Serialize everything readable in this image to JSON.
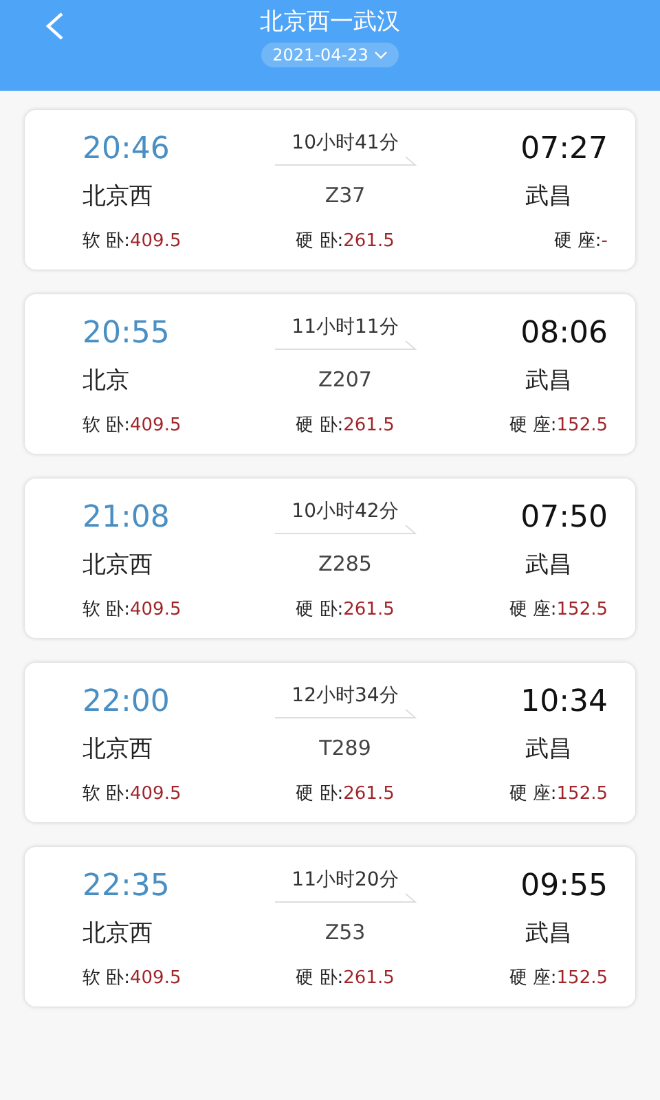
{
  "header": {
    "title": "北京西一武汉",
    "date": "2021-04-23"
  },
  "trains": [
    {
      "depart_time": "20:46",
      "duration": "10小时41分",
      "arrive_time": "07:27",
      "from": "北京西",
      "train_no": "Z37",
      "to": "武昌",
      "fares": [
        {
          "label": "软 卧:",
          "price": "409.5"
        },
        {
          "label": "硬 卧:",
          "price": "261.5"
        },
        {
          "label": "硬 座:",
          "price": "-"
        }
      ]
    },
    {
      "depart_time": "20:55",
      "duration": "11小时11分",
      "arrive_time": "08:06",
      "from": "北京",
      "train_no": "Z207",
      "to": "武昌",
      "fares": [
        {
          "label": "软 卧:",
          "price": "409.5"
        },
        {
          "label": "硬 卧:",
          "price": "261.5"
        },
        {
          "label": "硬 座:",
          "price": "152.5"
        }
      ]
    },
    {
      "depart_time": "21:08",
      "duration": "10小时42分",
      "arrive_time": "07:50",
      "from": "北京西",
      "train_no": "Z285",
      "to": "武昌",
      "fares": [
        {
          "label": "软 卧:",
          "price": "409.5"
        },
        {
          "label": "硬 卧:",
          "price": "261.5"
        },
        {
          "label": "硬 座:",
          "price": "152.5"
        }
      ]
    },
    {
      "depart_time": "22:00",
      "duration": "12小时34分",
      "arrive_time": "10:34",
      "from": "北京西",
      "train_no": "T289",
      "to": "武昌",
      "fares": [
        {
          "label": "软 卧:",
          "price": "409.5"
        },
        {
          "label": "硬 卧:",
          "price": "261.5"
        },
        {
          "label": "硬 座:",
          "price": "152.5"
        }
      ]
    },
    {
      "depart_time": "22:35",
      "duration": "11小时20分",
      "arrive_time": "09:55",
      "from": "北京西",
      "train_no": "Z53",
      "to": "武昌",
      "fares": [
        {
          "label": "软 卧:",
          "price": "409.5"
        },
        {
          "label": "硬 卧:",
          "price": "261.5"
        },
        {
          "label": "硬 座:",
          "price": "152.5"
        }
      ]
    }
  ]
}
